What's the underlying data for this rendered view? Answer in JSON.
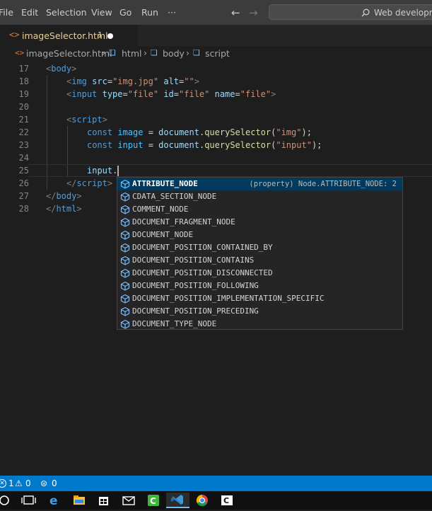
{
  "titlebar": {
    "menu": [
      "File",
      "Edit",
      "Selection",
      "View",
      "Go",
      "Run",
      "···"
    ],
    "search_placeholder": "Web development"
  },
  "tab": {
    "filename": "imageSelector.html",
    "problems": "1"
  },
  "breadcrumb": [
    "imageSelector.html",
    "html",
    "body",
    "script"
  ],
  "code_lines": [
    {
      "n": "17",
      "tokens": [
        [
          "t-tag",
          "<"
        ],
        [
          "t-el",
          "body"
        ],
        [
          "t-tag",
          ">"
        ]
      ],
      "indent": 0
    },
    {
      "n": "18",
      "tokens": [
        [
          "t-tag",
          "<"
        ],
        [
          "t-el",
          "img"
        ],
        [
          "t-plain",
          " "
        ],
        [
          "t-attr",
          "src"
        ],
        [
          "t-plain",
          "="
        ],
        [
          "t-str",
          "\"img.jpg\""
        ],
        [
          "t-plain",
          " "
        ],
        [
          "t-attr",
          "alt"
        ],
        [
          "t-plain",
          "="
        ],
        [
          "t-str",
          "\"\""
        ],
        [
          "t-tag",
          ">"
        ]
      ],
      "indent": 1
    },
    {
      "n": "19",
      "tokens": [
        [
          "t-tag",
          "<"
        ],
        [
          "t-el",
          "input"
        ],
        [
          "t-plain",
          " "
        ],
        [
          "t-attr",
          "type"
        ],
        [
          "t-plain",
          "="
        ],
        [
          "t-str",
          "\"file\""
        ],
        [
          "t-plain",
          " "
        ],
        [
          "t-attr",
          "id"
        ],
        [
          "t-plain",
          "="
        ],
        [
          "t-str",
          "\"file\""
        ],
        [
          "t-plain",
          " "
        ],
        [
          "t-attr",
          "name"
        ],
        [
          "t-plain",
          "="
        ],
        [
          "t-str",
          "\"file\""
        ],
        [
          "t-tag",
          ">"
        ]
      ],
      "indent": 1
    },
    {
      "n": "20",
      "tokens": [],
      "indent": 0
    },
    {
      "n": "21",
      "tokens": [
        [
          "t-tag",
          "<"
        ],
        [
          "t-el",
          "script"
        ],
        [
          "t-tag",
          ">"
        ]
      ],
      "indent": 1
    },
    {
      "n": "22",
      "tokens": [
        [
          "t-kw",
          "const"
        ],
        [
          "t-plain",
          " "
        ],
        [
          "t-var",
          "image"
        ],
        [
          "t-plain",
          " = "
        ],
        [
          "t-attr",
          "document"
        ],
        [
          "t-plain",
          "."
        ],
        [
          "t-fn",
          "querySelector"
        ],
        [
          "t-plain",
          "("
        ],
        [
          "t-str",
          "\"img\""
        ],
        [
          "t-plain",
          ");"
        ]
      ],
      "indent": 2
    },
    {
      "n": "23",
      "tokens": [
        [
          "t-kw",
          "const"
        ],
        [
          "t-plain",
          " "
        ],
        [
          "t-var",
          "input"
        ],
        [
          "t-plain",
          " = "
        ],
        [
          "t-attr",
          "document"
        ],
        [
          "t-plain",
          "."
        ],
        [
          "t-fn",
          "querySelector"
        ],
        [
          "t-plain",
          "("
        ],
        [
          "t-str",
          "\"input\""
        ],
        [
          "t-plain",
          ");"
        ]
      ],
      "indent": 2
    },
    {
      "n": "24",
      "tokens": [],
      "indent": 0
    },
    {
      "n": "25",
      "tokens": [
        [
          "t-attr",
          "input"
        ],
        [
          "t-plain",
          "."
        ]
      ],
      "indent": 2
    },
    {
      "n": "26",
      "tokens": [
        [
          "t-tag",
          "</"
        ],
        [
          "t-el",
          "script"
        ],
        [
          "t-tag",
          ">"
        ]
      ],
      "indent": 1
    },
    {
      "n": "27",
      "tokens": [
        [
          "t-tag",
          "</"
        ],
        [
          "t-el",
          "body"
        ],
        [
          "t-tag",
          ">"
        ]
      ],
      "indent": 0
    },
    {
      "n": "28",
      "tokens": [
        [
          "t-tag",
          "</"
        ],
        [
          "t-el",
          "html"
        ],
        [
          "t-tag",
          ">"
        ]
      ],
      "indent": 0
    }
  ],
  "suggestions": {
    "detail": "(property) Node.ATTRIBUTE_NODE: 2",
    "items": [
      "ATTRIBUTE_NODE",
      "CDATA_SECTION_NODE",
      "COMMENT_NODE",
      "DOCUMENT_FRAGMENT_NODE",
      "DOCUMENT_NODE",
      "DOCUMENT_POSITION_CONTAINED_BY",
      "DOCUMENT_POSITION_CONTAINS",
      "DOCUMENT_POSITION_DISCONNECTED",
      "DOCUMENT_POSITION_FOLLOWING",
      "DOCUMENT_POSITION_IMPLEMENTATION_SPECIFIC",
      "DOCUMENT_POSITION_PRECEDING",
      "DOCUMENT_TYPE_NODE"
    ]
  },
  "status": {
    "errors": "1",
    "warnings": "0",
    "ports": "0"
  },
  "colors": {
    "statusbar": "#007acc",
    "editor_bg": "#1e1e1e",
    "selection": "#04395e"
  },
  "taskbar_icons": [
    "search-circle-icon",
    "task-view-icon",
    "edge-icon",
    "file-explorer-icon",
    "store-icon",
    "mail-icon",
    "camtasia-icon",
    "vscode-icon",
    "chrome-icon",
    "terminal-icon"
  ]
}
